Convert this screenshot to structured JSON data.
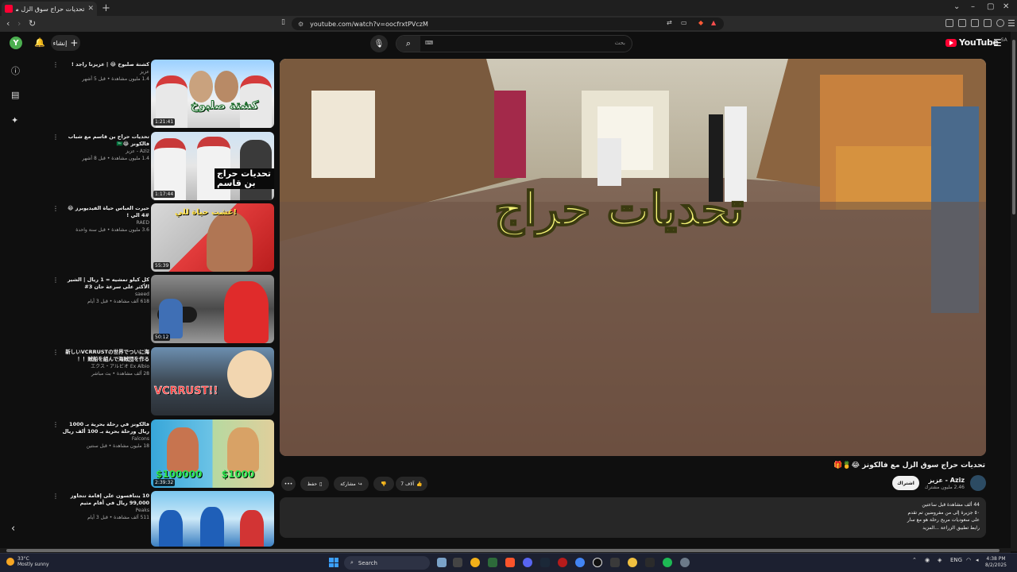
{
  "browser": {
    "tab_title": "تحديات حراج سوق الزل مع فالكونز",
    "tab_close": "✕",
    "new_tab": "+",
    "url": "youtube.com/watch?v=oocfrxtPVczM",
    "win_min": "–",
    "win_max": "▢",
    "win_close": "✕",
    "minimize_chev": "⌄"
  },
  "masthead": {
    "avatar_letter": "Y",
    "create_label": "إنشاء",
    "search_placeholder": "بحث",
    "keyboard_label": "⌨",
    "logo_text": "YouTube",
    "logo_region": "SA"
  },
  "player": {
    "overlay_text": "تحديات حراج"
  },
  "video": {
    "title": "تحديات حراج سوق الزل مع فالكونز 😂🍍🎁",
    "channel_name": "Aziz - عزيز",
    "subscribers": "2.46 مليون مشترك",
    "subscribe_label": "اشتراك",
    "likes_label": "7 آلاف",
    "share_label": "مشاركة",
    "save_label": "حفظ",
    "more_label": "•••",
    "description_lines": [
      "44 ألف مشاهدة قبل ساعتين",
      "٥٠ جزيرة إلى من مفروضين تم تقدم",
      "على سعوديات مربح رحلة هو مع سار",
      "رابط تطبيق الزراعة ...المزيد"
    ]
  },
  "recommendations": [
    {
      "title": "كشتة صلبوخ 😂 | عزيزنا راجد !",
      "channel": "عزيز",
      "stats": "1.4 مليون مشاهدة • قبل 5 أشهر",
      "duration": "1:21:41",
      "overlay": "كشتة صلبوخ"
    },
    {
      "title": "تحديات حراج بن قاسم مع شباب فالكونز 😂🇸🇦",
      "channel": "Aziz - عزيز",
      "stats": "1.4 مليون مشاهدة • قبل 8 أشهر",
      "duration": "1:17:44",
      "overlay": "تحديات حراج بن قاسم"
    },
    {
      "title": "حيرت العباس حياة الفيديوبرز 😂 #4 الي !",
      "channel": "RAED",
      "stats": "3.6 مليون مشاهدة • قبل سنة واحدة",
      "duration": "55:39",
      "overlay": "عشت حياة للي!"
    },
    {
      "title": "كل كيلو تمشيه = 1 ريال | الشير الأكثر على سرعة حان 3#",
      "channel": "saeed",
      "stats": "618 ألف مشاهدة • قبل 3 أيام",
      "duration": "50:12",
      "overlay": ""
    },
    {
      "title": "新しいVCRRUSTの世界でついに海賊船を組んで海賊団を作る！！",
      "channel": "エクス・アルビオ Ex Albio",
      "stats": "28 ألف مشاهدة • بث مباشر",
      "duration": "",
      "overlay": "VCRRUST!!"
    },
    {
      "title": "فالكونز في رحلة بحرية بـ 1000 ريال ورحلة بحرية بـ 100 ألف ريال 😂",
      "channel": "Falcons",
      "stats": "18 مليون مشاهدة • قبل سنتين",
      "duration": "2:39:32",
      "overlay": "$100000 $1000"
    },
    {
      "title": "10 يتنافسون على إقامة تتجاوز 99,000 ريال في أقام مثيم بالسعودية",
      "channel": "Peaks",
      "stats": "511 ألف مشاهدة • قبل 3 أيام",
      "duration": "",
      "overlay": ""
    }
  ],
  "taskbar": {
    "weather_temp": "33°C",
    "weather_desc": "Mostly sunny",
    "search_label": "Search",
    "lang": "ENG",
    "time": "4:38 PM",
    "date": "8/2/2025"
  }
}
